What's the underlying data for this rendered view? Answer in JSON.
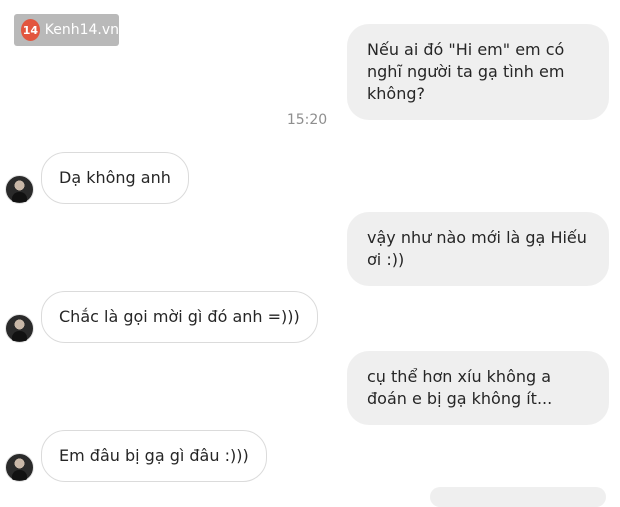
{
  "watermark": {
    "logo": "14",
    "text": "Kenh14.vn"
  },
  "timestamp": "15:20",
  "messages": [
    {
      "side": "out",
      "text": "Nếu ai đó \"Hi em\" em có nghĩ người ta gạ tình em không?"
    },
    {
      "side": "in",
      "text": "Dạ không anh"
    },
    {
      "side": "out",
      "text": "vậy như nào mới là gạ Hiếu ơi :))"
    },
    {
      "side": "in",
      "text": "Chắc là gọi mời gì đó anh =)))"
    },
    {
      "side": "out",
      "text": "cụ thể hơn xíu không a đoán e bị gạ không ít..."
    },
    {
      "side": "in",
      "text": "Em đâu bị gạ gì đâu :)))"
    }
  ]
}
